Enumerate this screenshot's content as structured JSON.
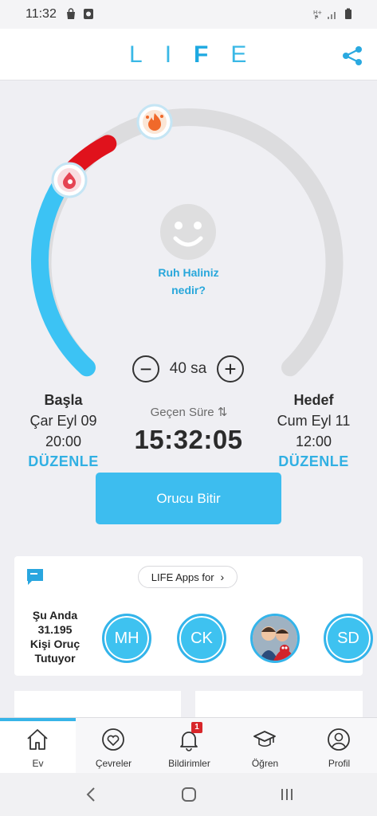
{
  "status_bar": {
    "time": "11:32"
  },
  "app": {
    "logo_letters": [
      "L",
      "I",
      "F",
      "E"
    ]
  },
  "mood": {
    "prompt_line1": "Ruh Haliniz",
    "prompt_line2": "nedir?"
  },
  "duration": {
    "minus": "−",
    "value": "40 sa",
    "plus": "+"
  },
  "start": {
    "title": "Başla",
    "date": "Çar Eyl 09",
    "time": "20:00",
    "edit": "DÜZENLE"
  },
  "elapsed": {
    "label": "Geçen Süre",
    "sort_icon": "⇅",
    "value": "15:32:05"
  },
  "goal": {
    "title": "Hedef",
    "date": "Cum Eyl 11",
    "time": "12:00",
    "edit": "DÜZENLE"
  },
  "end_button": {
    "label": "Orucu Bitir"
  },
  "community": {
    "apps_pill": "LIFE Apps for",
    "apps_chevron": "›",
    "count_line1": "Şu Anda",
    "count_line2": "31.195",
    "count_line3": "Kişi Oruç",
    "count_line4": "Tutuyor",
    "avatars": [
      "MH",
      "CK",
      "",
      "SD"
    ]
  },
  "tabs": [
    {
      "label": "Ev",
      "icon": "home-icon",
      "active": true
    },
    {
      "label": "Çevreler",
      "icon": "heart-circle-icon",
      "active": false
    },
    {
      "label": "Bildirimler",
      "icon": "bell-icon",
      "active": false,
      "badge": "1"
    },
    {
      "label": "Öğren",
      "icon": "graduation-cap-icon",
      "active": false
    },
    {
      "label": "Profil",
      "icon": "user-icon",
      "active": false
    }
  ],
  "colors": {
    "accent": "#3dbdef",
    "progress_red": "#e0121c",
    "track_gray": "#dcdcde"
  },
  "fast_progress": {
    "elapsed_hours": 15.54,
    "target_hours": 40
  }
}
